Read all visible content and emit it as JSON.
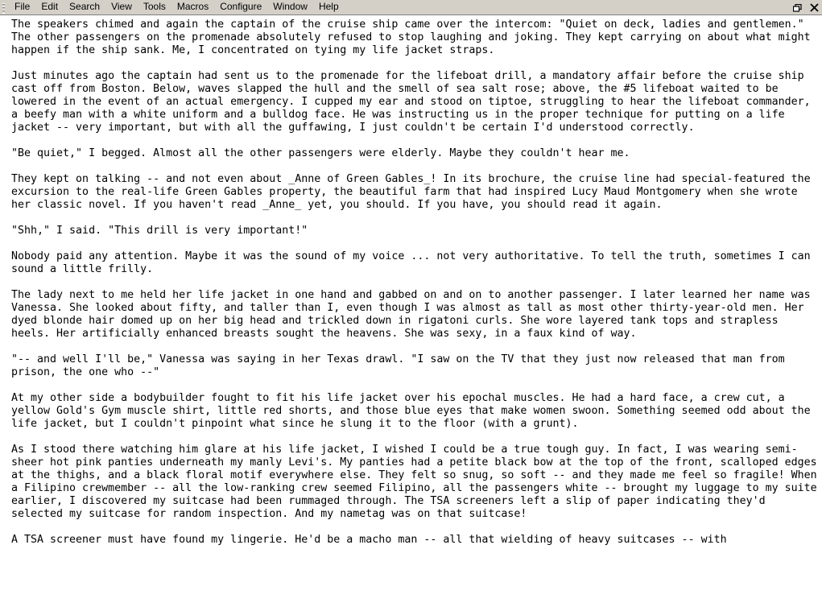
{
  "window": {
    "title": "text-editor",
    "controls": [
      {
        "name": "restore-button",
        "label": "restore"
      },
      {
        "name": "close-button",
        "label": "close"
      }
    ]
  },
  "menubar": {
    "grip": "drag-grip",
    "items": [
      {
        "label": "File"
      },
      {
        "label": "Edit"
      },
      {
        "label": "Search"
      },
      {
        "label": "View"
      },
      {
        "label": "Tools"
      },
      {
        "label": "Macros"
      },
      {
        "label": "Configure"
      },
      {
        "label": "Window"
      },
      {
        "label": "Help"
      }
    ]
  },
  "document": {
    "paragraphs": [
      "The speakers chimed and again the captain of the cruise ship came over the intercom: \"Quiet on deck, ladies and gentlemen.\" The other passengers on the promenade absolutely refused to stop laughing and joking. They kept carrying on about what might happen if the ship sank. Me, I concentrated on tying my life jacket straps.",
      "",
      "Just minutes ago the captain had sent us to the promenade for the lifeboat drill, a mandatory affair before the cruise ship cast off from Boston. Below, waves slapped the hull and the smell of sea salt rose; above, the #5 lifeboat waited to be lowered in the event of an actual emergency. I cupped my ear and stood on tiptoe, struggling to hear the lifeboat commander, a beefy man with a white uniform and a bulldog face. He was instructing us in the proper technique for putting on a life jacket -- very important, but with all the guffawing, I just couldn't be certain I'd understood correctly.",
      "",
      "\"Be quiet,\" I begged. Almost all the other passengers were elderly. Maybe they couldn't hear me.",
      "",
      "They kept on talking -- and not even about _Anne of Green Gables_! In its brochure, the cruise line had special-featured the excursion to the real-life Green Gables property, the beautiful farm that had inspired Lucy Maud Montgomery when she wrote her classic novel. If you haven't read _Anne_ yet, you should. If you have, you should read it again.",
      "",
      "\"Shh,\" I said. \"This drill is very important!\"",
      "",
      "Nobody paid any attention. Maybe it was the sound of my voice ... not very authoritative. To tell the truth, sometimes I can sound a little frilly.",
      "",
      "The lady next to me held her life jacket in one hand and gabbed on and on to another passenger. I later learned her name was Vanessa. She looked about fifty, and taller than I, even though I was almost as tall as most other thirty-year-old men. Her dyed blonde hair domed up on her big head and trickled down in rigatoni curls. She wore layered tank tops and strapless heels. Her artificially enhanced breasts sought the heavens. She was sexy, in a faux kind of way.",
      "",
      "\"-- and well I'll be,\" Vanessa was saying in her Texas drawl. \"I saw on the TV that they just now released that man from prison, the one who --\"",
      "",
      "At my other side a bodybuilder fought to fit his life jacket over his epochal muscles. He had a hard face, a crew cut, a yellow Gold's Gym muscle shirt, little red shorts, and those blue eyes that make women swoon. Something seemed odd about the life jacket, but I couldn't pinpoint what since he slung it to the floor (with a grunt).",
      "",
      "As I stood there watching him glare at his life jacket, I wished I could be a true tough guy. In fact, I was wearing semi-sheer hot pink panties underneath my manly Levi's. My panties had a petite black bow at the top of the front, scalloped edges at the thighs, and a black floral motif everywhere else. They felt so snug, so soft -- and they made me feel so fragile! When a Filipino crewmember -- all the low-ranking crew seemed Filipino, all the passengers white -- brought my luggage to my suite earlier, I discovered my suitcase had been rummaged through. The TSA screeners left a slip of paper indicating they'd selected my suitcase for random inspection. And my nametag was on that suitcase!",
      "",
      "A TSA screener must have found my lingerie. He'd be a macho man -- all that wielding of heavy suitcases -- with"
    ]
  }
}
